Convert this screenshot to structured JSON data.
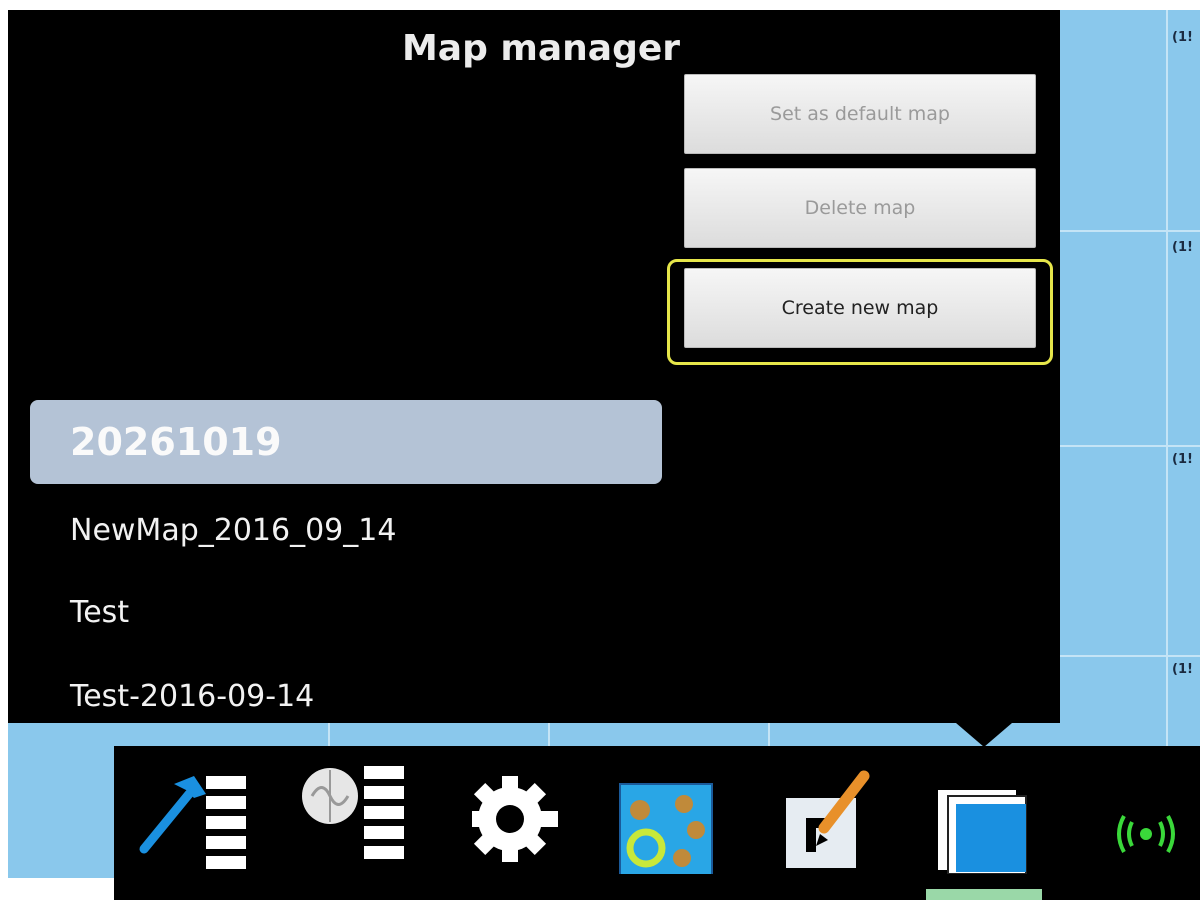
{
  "panel": {
    "title": "Map manager",
    "buttons": {
      "set_default": "Set as default map",
      "delete": "Delete map",
      "create": "Create new map"
    },
    "maps": [
      {
        "label": "20261019",
        "selected": true
      },
      {
        "label": "NewMap_2016_09_14",
        "selected": false
      },
      {
        "label": "Test",
        "selected": false
      },
      {
        "label": "Test-2016-09-14",
        "selected": false
      }
    ]
  },
  "background": {
    "cell_labels": [
      "(1!",
      "(1!",
      "(1!",
      "(1!"
    ]
  },
  "toolbar": {
    "tools": [
      {
        "icon": "hammer-list-icon"
      },
      {
        "icon": "brain-list-icon"
      },
      {
        "icon": "gear-icon"
      },
      {
        "icon": "map-circles-icon"
      },
      {
        "icon": "edit-pencil-icon"
      },
      {
        "icon": "map-manager-icon",
        "active": true
      },
      {
        "icon": "wireless-signal-icon"
      }
    ]
  },
  "colors": {
    "panel_bg": "#000000",
    "selected_item": "#b4c3d6",
    "focus_ring": "#e6e64a",
    "map_bg": "#8ac8ec",
    "active_indicator": "#9ad8a8",
    "accent_blue": "#1a90e0",
    "signal_green": "#3ad83a"
  }
}
